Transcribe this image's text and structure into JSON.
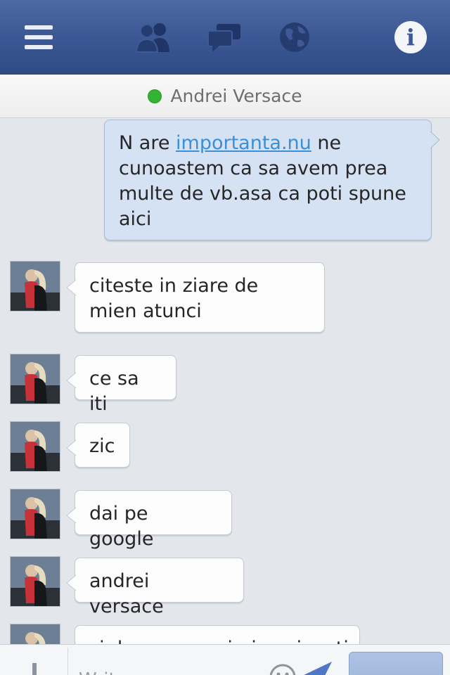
{
  "colors": {
    "topbar": "#3d5a96",
    "outgoing_bubble": "#d5e2f3",
    "incoming_bubble": "#fdfdfd",
    "online": "#34b233",
    "link": "#3a8fd6",
    "background": "#e3e7ec"
  },
  "topbar": {
    "icons": [
      "menu-icon",
      "friends-icon",
      "messages-icon",
      "globe-icon",
      "info-icon"
    ],
    "info_glyph": "i"
  },
  "contact": {
    "name": "Andrei Versace",
    "status": "online"
  },
  "conversation": {
    "outgoing": [
      {
        "before_link": "N are ",
        "link": "importanta.nu",
        "after_link": " ne cunoastem ca sa avem prea multe de vb.asa ca poti spune aici"
      }
    ],
    "incoming": [
      "citeste in ziare de mien atunci",
      "ce sa iti",
      "zic",
      "dai pe google",
      "andrei versace",
      "si dupa aceea imi spui ce tiram :)"
    ]
  },
  "composer": {
    "placeholder": "Write a message...",
    "send_label": "Send"
  }
}
